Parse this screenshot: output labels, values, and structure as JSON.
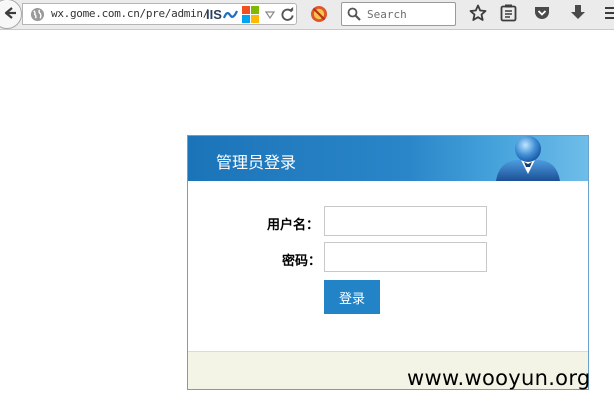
{
  "browser": {
    "url": "wx.gome.com.cn/pre/admin/",
    "iis_label": "IIS",
    "search_placeholder": "Search",
    "colors": {
      "toolbar": "#ebebeb",
      "ms_red": "#f25022",
      "ms_green": "#7fba00",
      "ms_blue": "#00a4ef",
      "ms_yellow": "#ffb900"
    },
    "icons": [
      "back-arrow-icon",
      "globe-icon",
      "iis-icon",
      "windows-logo-icon",
      "dropdown-arrow-icon",
      "reload-icon",
      "addon-blocker-icon",
      "search-icon",
      "bookmark-star-icon",
      "reading-list-icon",
      "pocket-icon",
      "download-icon"
    ]
  },
  "login": {
    "title": "管理员登录",
    "username_label": "用户名：",
    "password_label": "密码：",
    "username_value": "",
    "password_value": "",
    "submit_label": "登录",
    "colors": {
      "header": "#1c74b8",
      "button": "#2284c7",
      "footer": "#f4f4e6"
    }
  },
  "watermark": "www.wooyun.org"
}
